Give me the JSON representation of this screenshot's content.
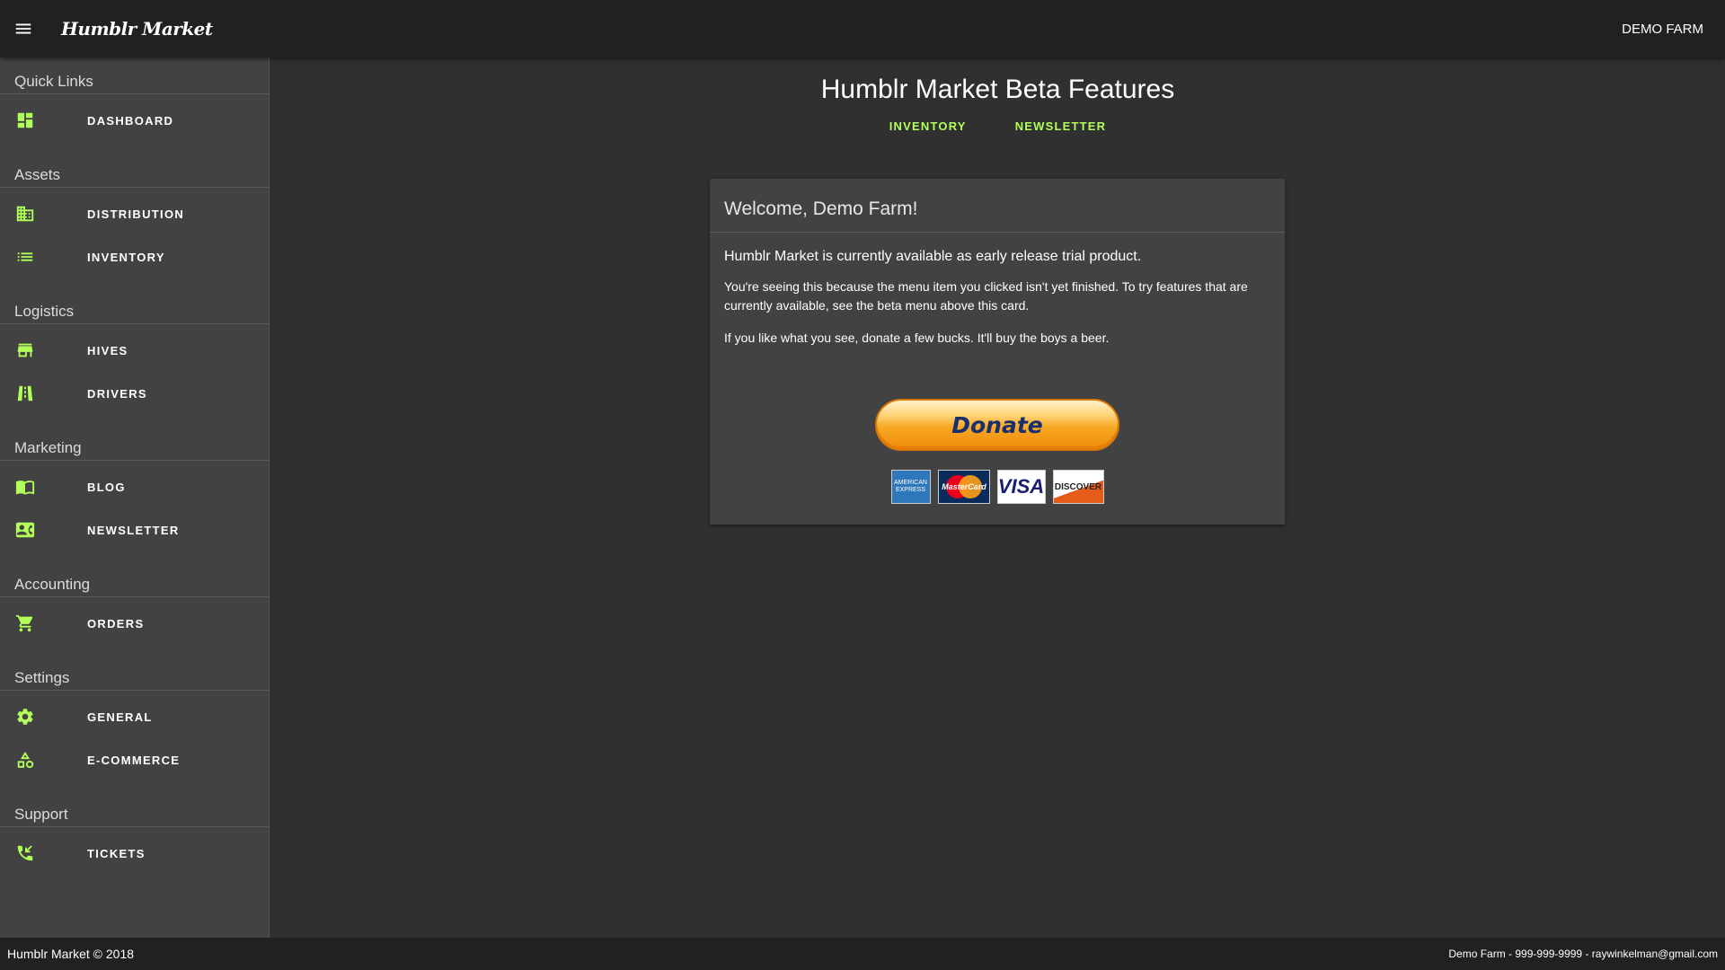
{
  "header": {
    "brand": "Humblr Market",
    "farm_name": "DEMO FARM"
  },
  "sidebar": {
    "sections": [
      {
        "title": "Quick Links",
        "items": [
          {
            "label": "DASHBOARD",
            "icon": "dashboard-icon"
          }
        ]
      },
      {
        "title": "Assets",
        "items": [
          {
            "label": "DISTRIBUTION",
            "icon": "building-icon"
          },
          {
            "label": "INVENTORY",
            "icon": "list-icon"
          }
        ]
      },
      {
        "title": "Logistics",
        "items": [
          {
            "label": "HIVES",
            "icon": "store-icon"
          },
          {
            "label": "DRIVERS",
            "icon": "road-icon"
          }
        ]
      },
      {
        "title": "Marketing",
        "items": [
          {
            "label": "BLOG",
            "icon": "book-icon"
          },
          {
            "label": "NEWSLETTER",
            "icon": "contact-card-icon"
          }
        ]
      },
      {
        "title": "Accounting",
        "items": [
          {
            "label": "ORDERS",
            "icon": "cart-icon"
          }
        ]
      },
      {
        "title": "Settings",
        "items": [
          {
            "label": "GENERAL",
            "icon": "gear-icon"
          },
          {
            "label": "E-COMMERCE",
            "icon": "shapes-icon"
          }
        ]
      },
      {
        "title": "Support",
        "items": [
          {
            "label": "TICKETS",
            "icon": "phone-callback-icon"
          }
        ]
      }
    ]
  },
  "main": {
    "title": "Humblr Market Beta Features",
    "tabs": [
      "INVENTORY",
      "NEWSLETTER"
    ],
    "card": {
      "title": "Welcome, Demo Farm!",
      "lead": "Humblr Market is currently available as early release trial product.",
      "paragraph1": "You're seeing this because the menu item you clicked isn't yet finished. To try features that are currently available, see the beta menu above this card.",
      "paragraph2": "If you like what you see, donate a few bucks. It'll buy the boys a beer.",
      "donate_label": "Donate",
      "payment_cards": [
        "AMERICAN EXPRESS",
        "MasterCard",
        "VISA",
        "DISCOVER"
      ]
    }
  },
  "footer": {
    "left": "Humblr Market © 2018",
    "right": "Demo Farm - 999-999-9999 - raywinkelman@gmail.com"
  },
  "colors": {
    "accent": "#b2ff59",
    "appbar": "#212121",
    "sidebar": "#424242",
    "background": "#303030"
  }
}
